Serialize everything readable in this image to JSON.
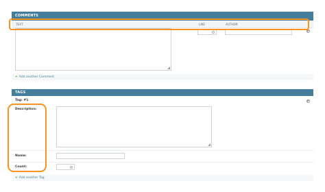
{
  "comments": {
    "header": "COMMENTS",
    "columns": {
      "text": "TEXT",
      "like": "LIKE",
      "author": "AUTHOR"
    },
    "add_label": "Add another Comment"
  },
  "tags": {
    "header": "TAGS",
    "item_title": "Tag: #1",
    "fields": {
      "description": "Description:",
      "name": "Name:",
      "count": "Count:"
    },
    "add_label": "Add another Tag"
  },
  "colors": {
    "header_bg": "#447e9b",
    "highlight": "#f7931e",
    "add_plus": "#3c9a3c"
  }
}
